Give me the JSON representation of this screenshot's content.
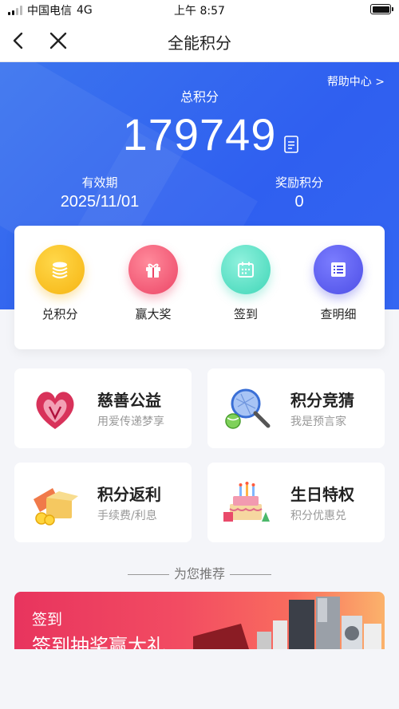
{
  "status_bar": {
    "carrier": "中国电信",
    "network": "4G",
    "time": "上午 8:57"
  },
  "nav": {
    "title": "全能积分",
    "back_icon": "chevron-left-icon",
    "close_icon": "close-icon"
  },
  "hero": {
    "help_link": "帮助中心 >",
    "total_label": "总积分",
    "total_value": "179749",
    "valid_label": "有效期",
    "valid_value": "2025/11/01",
    "bonus_label": "奖励积分",
    "bonus_value": "0",
    "accent_color": "#3468f0"
  },
  "actions": [
    {
      "label": "兑积分",
      "icon": "coins-icon",
      "color": "#f6b411"
    },
    {
      "label": "赢大奖",
      "icon": "gift-icon",
      "color": "#ec4566"
    },
    {
      "label": "签到",
      "icon": "calendar-icon",
      "color": "#3fd6b7"
    },
    {
      "label": "查明细",
      "icon": "list-icon",
      "color": "#4d4ee6"
    }
  ],
  "features": [
    {
      "title": "慈善公益",
      "subtitle": "用爱传递梦享",
      "icon": "heart-hands-icon"
    },
    {
      "title": "积分竞猜",
      "subtitle": "我是预言家",
      "icon": "tennis-racket-icon"
    },
    {
      "title": "积分返利",
      "subtitle": "手续费/利息",
      "icon": "money-box-icon"
    },
    {
      "title": "生日特权",
      "subtitle": "积分优惠兑",
      "icon": "birthday-cake-icon"
    }
  ],
  "recommend": {
    "heading": "为您推荐"
  },
  "banner": {
    "line1": "签到",
    "line2": "签到抽奖赢大礼"
  }
}
